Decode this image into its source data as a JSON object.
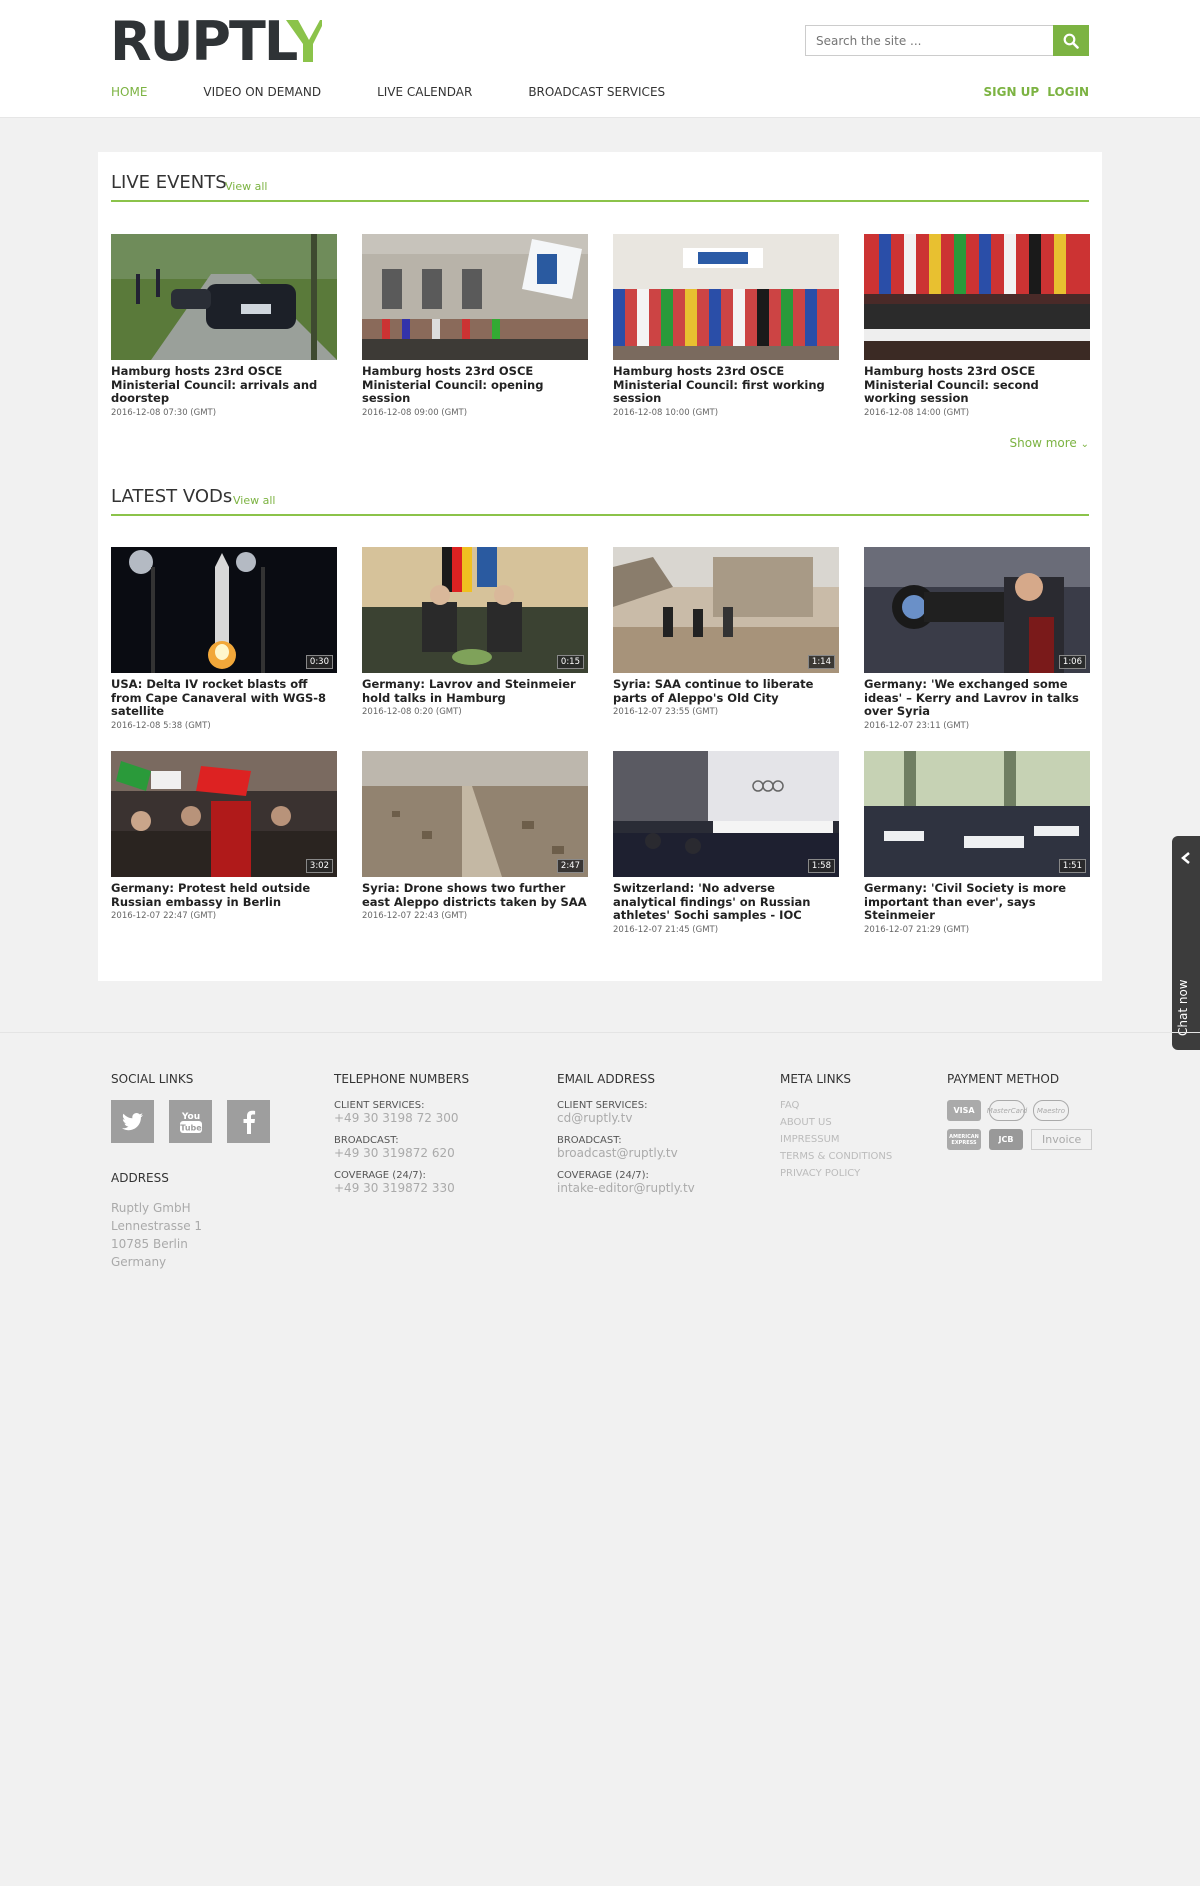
{
  "header": {
    "logo_text": "RUPTLY",
    "search_placeholder": "Search the site ...",
    "nav": [
      "HOME",
      "VIDEO ON DEMAND",
      "LIVE CALENDAR",
      "BROADCAST SERVICES"
    ],
    "signup": "SIGN UP",
    "login": "LOGIN",
    "accent_color": "#7cb342"
  },
  "live_events": {
    "title": "LIVE EVENTS",
    "view_all": "View all",
    "items": [
      {
        "title": "Hamburg hosts 23rd OSCE Ministerial Council: arrivals and doorstep",
        "date": "2016-12-08 07:30 (GMT)"
      },
      {
        "title": "Hamburg hosts 23rd OSCE Ministerial Council: opening session",
        "date": "2016-12-08 09:00 (GMT)"
      },
      {
        "title": "Hamburg hosts 23rd OSCE Ministerial Council: first working session",
        "date": "2016-12-08 10:00 (GMT)"
      },
      {
        "title": "Hamburg hosts 23rd OSCE Ministerial Council: second working session",
        "date": "2016-12-08 14:00 (GMT)"
      }
    ],
    "show_more": "Show more"
  },
  "latest_vods": {
    "title": "LATEST VODs",
    "view_all": "View all",
    "items": [
      {
        "title": "USA: Delta IV rocket blasts off from Cape Canaveral with WGS-8 satellite",
        "date": "2016-12-08 5:38 (GMT)",
        "duration": "0:30"
      },
      {
        "title": "Germany: Lavrov and Steinmeier hold talks in Hamburg",
        "date": "2016-12-08 0:20 (GMT)",
        "duration": "0:15"
      },
      {
        "title": "Syria: SAA continue to liberate parts of Aleppo's Old City",
        "date": "2016-12-07 23:55 (GMT)",
        "duration": "1:14"
      },
      {
        "title": "Germany: 'We exchanged some ideas' – Kerry and Lavrov in talks over Syria",
        "date": "2016-12-07 23:11 (GMT)",
        "duration": "1:06"
      },
      {
        "title": "Germany: Protest held outside Russian embassy in Berlin",
        "date": "2016-12-07 22:47 (GMT)",
        "duration": "3:02"
      },
      {
        "title": "Syria: Drone shows two further east Aleppo districts taken by SAA",
        "date": "2016-12-07 22:43 (GMT)",
        "duration": "2:47"
      },
      {
        "title": "Switzerland: 'No adverse analytical findings' on Russian athletes' Sochi samples - IOC",
        "date": "2016-12-07 21:45 (GMT)",
        "duration": "1:58"
      },
      {
        "title": "Germany: 'Civil Society is more important than ever', says Steinmeier",
        "date": "2016-12-07 21:29 (GMT)",
        "duration": "1:51"
      }
    ]
  },
  "footer": {
    "social_title": "SOCIAL LINKS",
    "address_title": "ADDRESS",
    "address_lines": [
      "Ruptly GmbH",
      "Lennestrasse 1",
      "10785 Berlin",
      "Germany"
    ],
    "telephone_title": "TELEPHONE NUMBERS",
    "telephones": [
      {
        "label": "CLIENT SERVICES:",
        "value": "+49 30 3198 72 300"
      },
      {
        "label": "BROADCAST:",
        "value": "+49 30 319872 620"
      },
      {
        "label": "COVERAGE (24/7):",
        "value": "+49 30 319872 330"
      }
    ],
    "email_title": "EMAIL ADDRESS",
    "emails": [
      {
        "label": "CLIENT SERVICES:",
        "value": "cd@ruptly.tv"
      },
      {
        "label": "BROADCAST:",
        "value": "broadcast@ruptly.tv"
      },
      {
        "label": "COVERAGE (24/7):",
        "value": "intake-editor@ruptly.tv"
      }
    ],
    "meta_title": "META LINKS",
    "meta_links": [
      "FAQ",
      "ABOUT US",
      "IMPRESSUM",
      "TERMS & CONDITIONS",
      "PRIVACY POLICY"
    ],
    "payment_title": "PAYMENT METHOD",
    "payment_icons": [
      "VISA",
      "MasterCard",
      "Maestro",
      "AMERICAN EXPRESS",
      "JCB"
    ],
    "invoice_label": "Invoice"
  },
  "chat": {
    "label": "Chat now"
  }
}
